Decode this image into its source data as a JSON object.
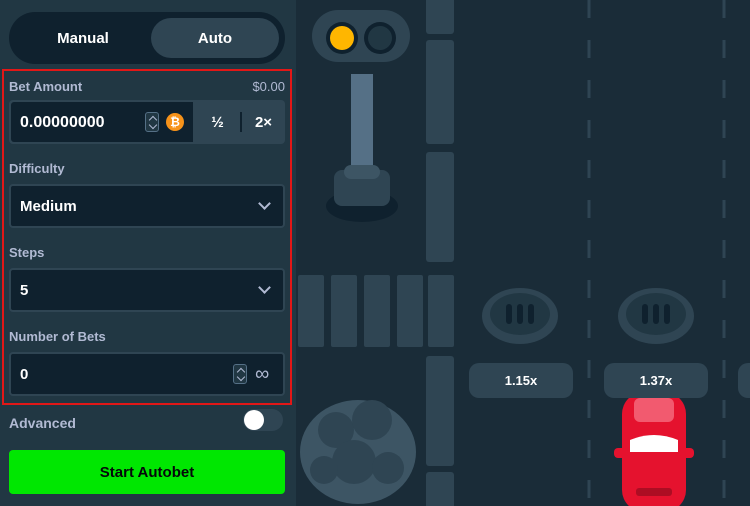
{
  "mode_tabs": {
    "manual": "Manual",
    "auto": "Auto"
  },
  "bet": {
    "label": "Bet Amount",
    "usd_value": "$0.00",
    "amount": "0.00000000",
    "currency_icon": "bitcoin-icon",
    "half_label": "½",
    "double_label": "2×"
  },
  "difficulty": {
    "label": "Difficulty",
    "selected": "Medium"
  },
  "steps": {
    "label": "Steps",
    "selected": "5"
  },
  "number_of_bets": {
    "label": "Number of Bets",
    "value": "0",
    "icon": "infinity-icon"
  },
  "advanced": {
    "label": "Advanced",
    "enabled": false
  },
  "start_button": {
    "label": "Start Autobet"
  },
  "game": {
    "multipliers": [
      "1.15x",
      "1.37x"
    ],
    "traffic_light": {
      "active": "yellow"
    }
  },
  "colors": {
    "sidebar": "#213743",
    "input_bg": "#0f212e",
    "accent_green": "#00e701",
    "highlight_border": "#e21717",
    "game_bg": "#1a2c38",
    "car": "#e5122e"
  }
}
